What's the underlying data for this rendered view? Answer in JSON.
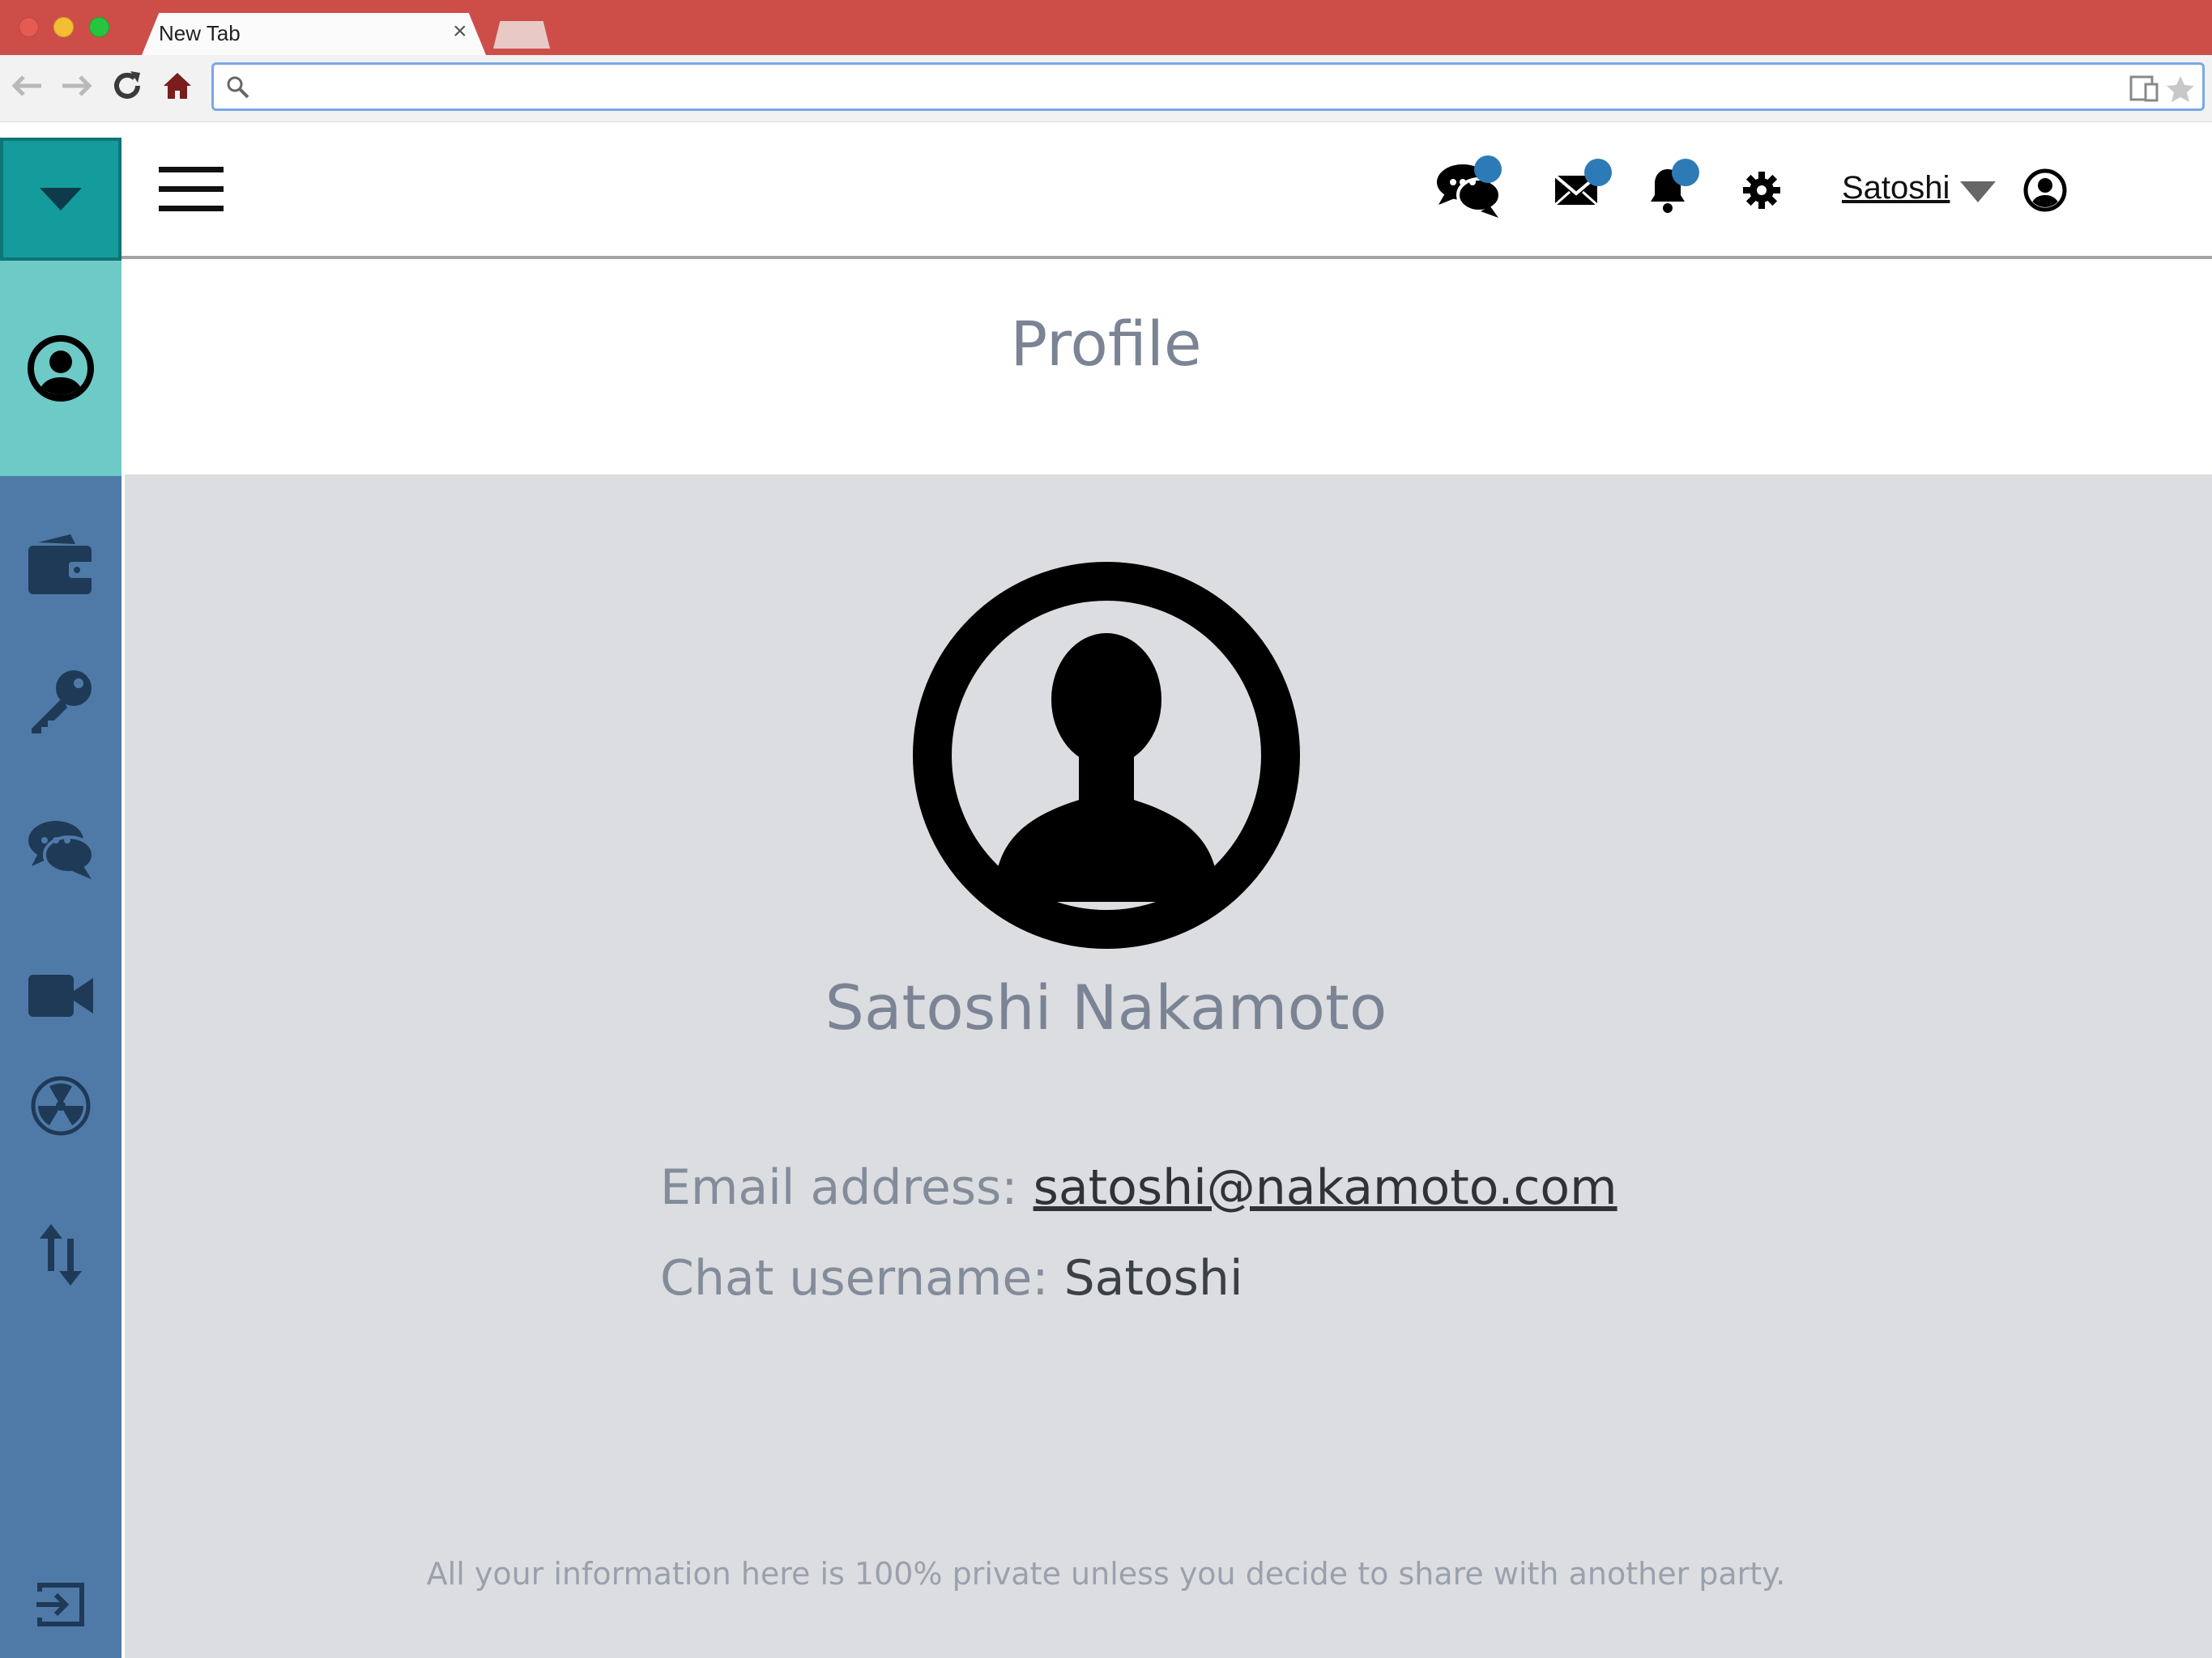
{
  "browser": {
    "tab_title": "New Tab",
    "tab_close": "×",
    "address_value": "",
    "icons": [
      "back-arrow-icon",
      "forward-arrow-icon",
      "reload-icon",
      "home-icon",
      "search-icon",
      "device-icon",
      "star-icon"
    ]
  },
  "sidebar": {
    "items": [
      "profile",
      "wallet",
      "keys",
      "chat",
      "video",
      "radiation",
      "transfer",
      "logout"
    ],
    "colors": {
      "primary": "#4f7aa8",
      "toggle": "#149c9c",
      "active": "#6dcac6"
    }
  },
  "header": {
    "user_name": "Satoshi",
    "badge_color": "#2c7bb6"
  },
  "page": {
    "title": "Profile",
    "full_name": "Satoshi Nakamoto",
    "email_label": "Email address:",
    "email_value": "satoshi@nakamoto.com",
    "chat_label": "Chat username:",
    "chat_value": "Satoshi",
    "footer_note": "All your information here is 100% private unless you decide to share with another party."
  }
}
